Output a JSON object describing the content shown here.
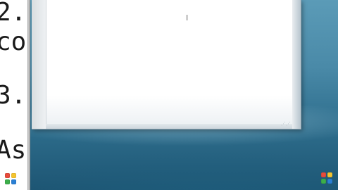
{
  "document": {
    "lines": [
      "2.",
      "co",
      "3.",
      "As"
    ]
  },
  "window": {
    "cursor_glyph": "I",
    "resize_grip_glyph": "⋰⋰"
  },
  "logo": {
    "colors": [
      "#e74c3c",
      "#f4c430",
      "#3cae4a",
      "#2a7fd4"
    ]
  }
}
